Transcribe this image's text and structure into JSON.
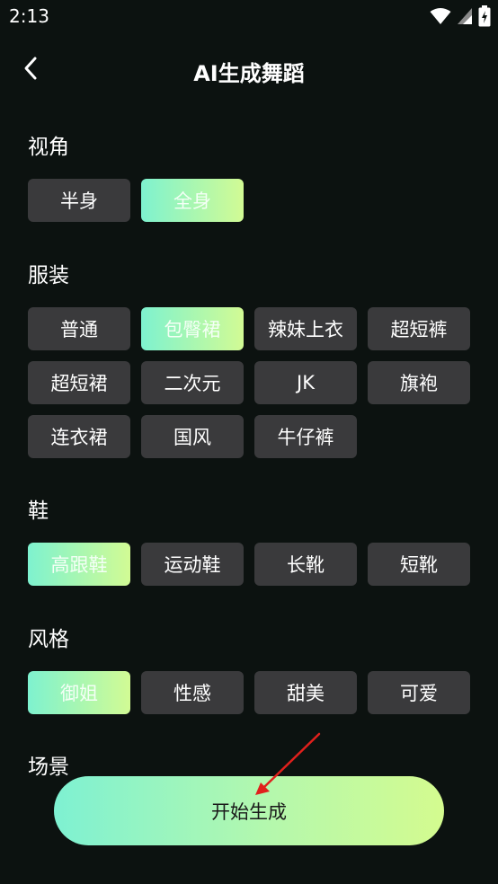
{
  "status_bar": {
    "time": "2:13"
  },
  "header": {
    "title": "AI生成舞蹈"
  },
  "sections": {
    "view": {
      "title": "视角",
      "options": [
        {
          "label": "半身",
          "selected": false
        },
        {
          "label": "全身",
          "selected": true
        }
      ]
    },
    "outfit": {
      "title": "服装",
      "options": [
        {
          "label": "普通",
          "selected": false
        },
        {
          "label": "包臀裙",
          "selected": true
        },
        {
          "label": "辣妹上衣",
          "selected": false
        },
        {
          "label": "超短裤",
          "selected": false
        },
        {
          "label": "超短裙",
          "selected": false
        },
        {
          "label": "二次元",
          "selected": false
        },
        {
          "label": "JK",
          "selected": false
        },
        {
          "label": "旗袍",
          "selected": false
        },
        {
          "label": "连衣裙",
          "selected": false
        },
        {
          "label": "国风",
          "selected": false
        },
        {
          "label": "牛仔裤",
          "selected": false
        }
      ]
    },
    "shoes": {
      "title": "鞋",
      "options": [
        {
          "label": "高跟鞋",
          "selected": true
        },
        {
          "label": "运动鞋",
          "selected": false
        },
        {
          "label": "长靴",
          "selected": false
        },
        {
          "label": "短靴",
          "selected": false
        }
      ]
    },
    "style": {
      "title": "风格",
      "options": [
        {
          "label": "御姐",
          "selected": true
        },
        {
          "label": "性感",
          "selected": false
        },
        {
          "label": "甜美",
          "selected": false
        },
        {
          "label": "可爱",
          "selected": false
        }
      ]
    },
    "scene": {
      "title": "场景"
    }
  },
  "actions": {
    "start_label": "开始生成"
  },
  "colors": {
    "background": "#0c1210",
    "chip": "#3a3a3c",
    "gradient_start": "#7ef2cf",
    "gradient_end": "#d2fb94",
    "annotation_arrow": "#e0201c"
  },
  "icons": {
    "back": "chevron-left-icon",
    "wifi": "wifi-icon",
    "signal": "signal-icon",
    "battery": "battery-charging-icon"
  }
}
